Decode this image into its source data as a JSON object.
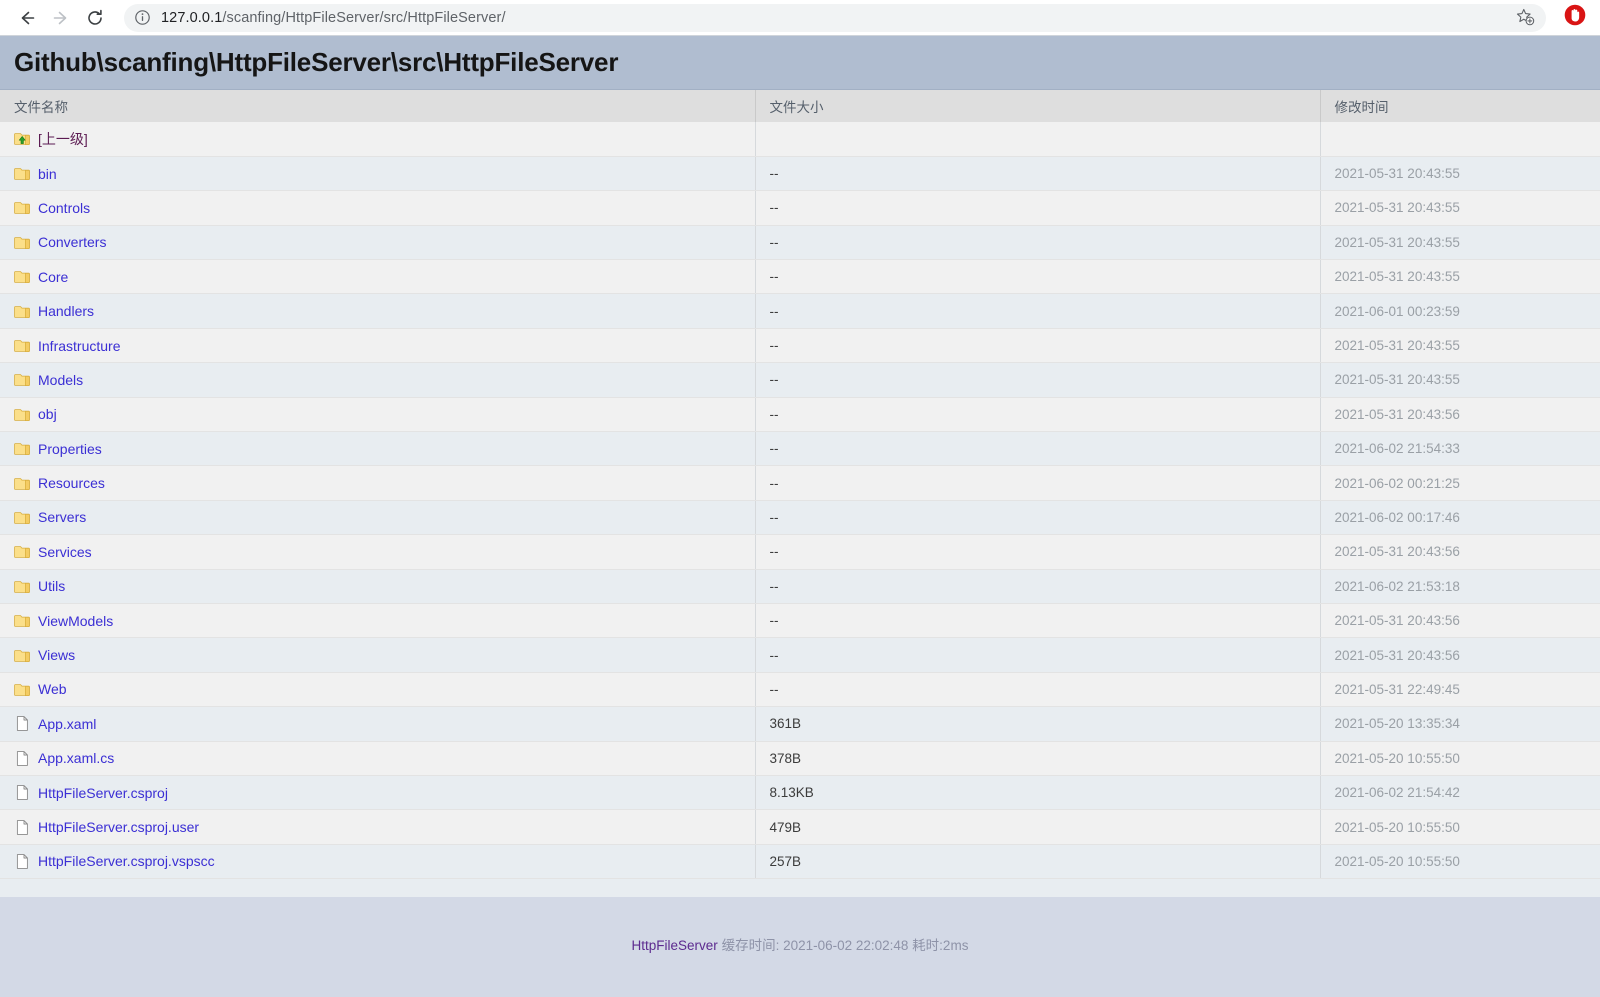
{
  "browser": {
    "back_icon": "back-arrow-icon",
    "forward_icon": "forward-arrow-icon",
    "reload_icon": "reload-icon",
    "info_icon": "info-circle-icon",
    "bookmark_icon": "star-add-icon",
    "extension_icon": "adblock-hand-icon",
    "url_domain": "127.0.0.1",
    "url_path": "/scanfing/HttpFileServer/src/HttpFileServer/"
  },
  "page": {
    "title": "Github\\scanfing\\HttpFileServer\\src\\HttpFileServer",
    "columns": {
      "name": "文件名称",
      "size": "文件大小",
      "time": "修改时间"
    },
    "rows": [
      {
        "name": "[上一级]",
        "size": "",
        "time": "",
        "kind": "updir"
      },
      {
        "name": "bin",
        "size": "--",
        "time": "2021-05-31 20:43:55",
        "kind": "folder"
      },
      {
        "name": "Controls",
        "size": "--",
        "time": "2021-05-31 20:43:55",
        "kind": "folder"
      },
      {
        "name": "Converters",
        "size": "--",
        "time": "2021-05-31 20:43:55",
        "kind": "folder"
      },
      {
        "name": "Core",
        "size": "--",
        "time": "2021-05-31 20:43:55",
        "kind": "folder"
      },
      {
        "name": "Handlers",
        "size": "--",
        "time": "2021-06-01 00:23:59",
        "kind": "folder"
      },
      {
        "name": "Infrastructure",
        "size": "--",
        "time": "2021-05-31 20:43:55",
        "kind": "folder"
      },
      {
        "name": "Models",
        "size": "--",
        "time": "2021-05-31 20:43:55",
        "kind": "folder"
      },
      {
        "name": "obj",
        "size": "--",
        "time": "2021-05-31 20:43:56",
        "kind": "folder"
      },
      {
        "name": "Properties",
        "size": "--",
        "time": "2021-06-02 21:54:33",
        "kind": "folder"
      },
      {
        "name": "Resources",
        "size": "--",
        "time": "2021-06-02 00:21:25",
        "kind": "folder"
      },
      {
        "name": "Servers",
        "size": "--",
        "time": "2021-06-02 00:17:46",
        "kind": "folder"
      },
      {
        "name": "Services",
        "size": "--",
        "time": "2021-05-31 20:43:56",
        "kind": "folder"
      },
      {
        "name": "Utils",
        "size": "--",
        "time": "2021-06-02 21:53:18",
        "kind": "folder"
      },
      {
        "name": "ViewModels",
        "size": "--",
        "time": "2021-05-31 20:43:56",
        "kind": "folder"
      },
      {
        "name": "Views",
        "size": "--",
        "time": "2021-05-31 20:43:56",
        "kind": "folder"
      },
      {
        "name": "Web",
        "size": "--",
        "time": "2021-05-31 22:49:45",
        "kind": "folder"
      },
      {
        "name": "App.xaml",
        "size": "361B",
        "time": "2021-05-20 13:35:34",
        "kind": "file"
      },
      {
        "name": "App.xaml.cs",
        "size": "378B",
        "time": "2021-05-20 10:55:50",
        "kind": "file"
      },
      {
        "name": "HttpFileServer.csproj",
        "size": "8.13KB",
        "time": "2021-06-02 21:54:42",
        "kind": "file"
      },
      {
        "name": "HttpFileServer.csproj.user",
        "size": "479B",
        "time": "2021-05-20 10:55:50",
        "kind": "file"
      },
      {
        "name": "HttpFileServer.csproj.vspscc",
        "size": "257B",
        "time": "2021-05-20 10:55:50",
        "kind": "file"
      }
    ]
  },
  "footer": {
    "link": "HttpFileServer",
    "meta": "缓存时间: 2021-06-02 22:02:48 耗时:2ms"
  },
  "colors": {
    "title_bar": "#b0bdd0",
    "header_row": "#dedede",
    "row_odd": "#f1f1f1",
    "row_even": "#e8edf1",
    "link": "#3b2fd4",
    "updir_link": "#5c1b52",
    "footer_bg": "#d3d9e6",
    "extension_red": "#d91414"
  }
}
